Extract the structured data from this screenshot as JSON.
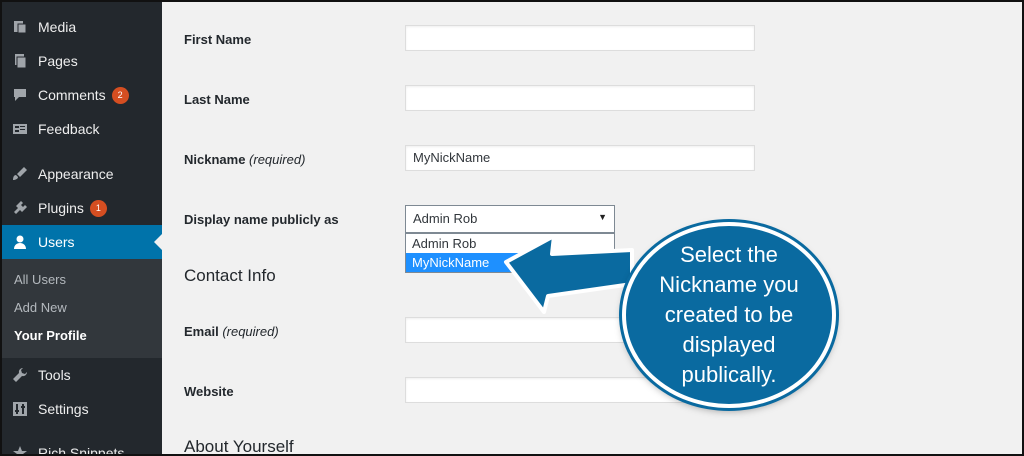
{
  "sidebar": {
    "items": [
      {
        "label": "Media",
        "icon": "media-icon"
      },
      {
        "label": "Pages",
        "icon": "pages-icon"
      },
      {
        "label": "Comments",
        "icon": "comments-icon",
        "badge": "2"
      },
      {
        "label": "Feedback",
        "icon": "feedback-icon"
      },
      {
        "label": "Appearance",
        "icon": "appearance-icon"
      },
      {
        "label": "Plugins",
        "icon": "plugins-icon",
        "badge": "1"
      },
      {
        "label": "Users",
        "icon": "users-icon",
        "active": true
      },
      {
        "label": "Tools",
        "icon": "tools-icon"
      },
      {
        "label": "Settings",
        "icon": "settings-icon"
      },
      {
        "label": "Rich Snippets",
        "icon": "rich-snippets-icon"
      }
    ],
    "submenu": [
      "All Users",
      "Add New",
      "Your Profile"
    ]
  },
  "form": {
    "first_name_label": "First Name",
    "first_name_value": "",
    "last_name_label": "Last Name",
    "last_name_value": "",
    "nickname_label": "Nickname",
    "nickname_required": "(required)",
    "nickname_value": "MyNickName",
    "display_name_label": "Display name publicly as",
    "display_name_selected": "Admin Rob",
    "display_name_options": [
      "Admin Rob",
      "MyNickName"
    ],
    "contact_info_heading": "Contact Info",
    "email_label": "Email",
    "email_required": "(required)",
    "email_value": "",
    "website_label": "Website",
    "website_value": "",
    "about_heading": "About Yourself"
  },
  "callout": {
    "text": "Select the Nickname you created to be displayed publically."
  },
  "colors": {
    "sidebar_bg": "#23282d",
    "active_bg": "#0073aa",
    "badge": "#d54e21",
    "callout": "#0a6aa0",
    "option_highlight": "#1e90ff"
  }
}
